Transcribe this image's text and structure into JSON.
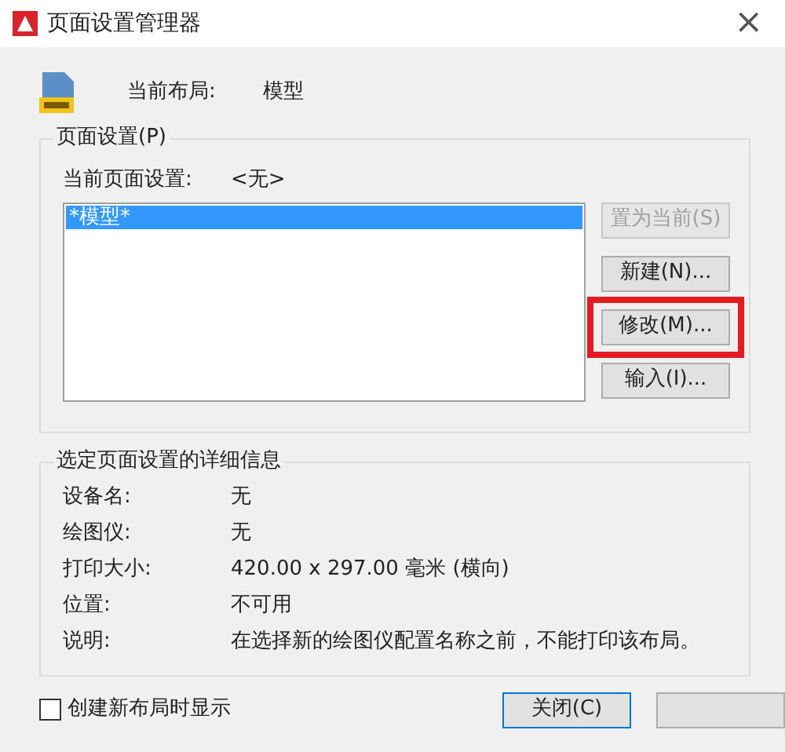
{
  "window": {
    "title": "页面设置管理器",
    "close": "×"
  },
  "current_layout": {
    "label": "当前布局:",
    "value": "模型"
  },
  "page_setups": {
    "title": "页面设置(P)",
    "current_label": "当前页面设置:",
    "current_value": "<无>",
    "items": [
      {
        "label": "*模型*",
        "selected": true
      }
    ],
    "buttons": [
      {
        "label": "置为当前(S)",
        "disabled": true,
        "highlighted": false
      },
      {
        "label": "新建(N)...",
        "disabled": false,
        "highlighted": false
      },
      {
        "label": "修改(M)...",
        "disabled": false,
        "highlighted": true
      },
      {
        "label": "输入(I)...",
        "disabled": false,
        "highlighted": false
      }
    ]
  },
  "details": {
    "title": "选定页面设置的详细信息",
    "rows": [
      {
        "label": "设备名:",
        "value": "无"
      },
      {
        "label": "绘图仪:",
        "value": "无"
      },
      {
        "label": "打印大小:",
        "value": "420.00 x 297.00 毫米 (横向)"
      },
      {
        "label": "位置:",
        "value": "不可用"
      },
      {
        "label": "说明:",
        "value": "在选择新的绘图仪配置名称之前，不能打印该布局。"
      }
    ]
  },
  "show_on_create": {
    "label": "创建新布局时显示",
    "checked": false
  },
  "footer_buttons": [
    {
      "label": "关闭(C)"
    }
  ]
}
